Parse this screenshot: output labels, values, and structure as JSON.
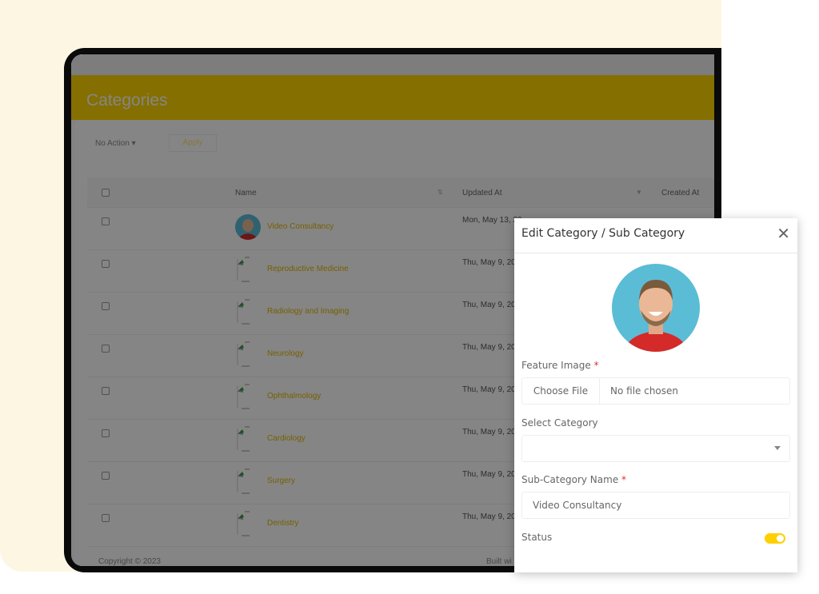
{
  "page": {
    "title": "Categories",
    "bulk_action": "No Action ▾",
    "apply_label": "Apply"
  },
  "table": {
    "headers": {
      "name": "Name",
      "updated_at": "Updated At",
      "created_at": "Created At"
    },
    "rows": [
      {
        "name": "Video Consultancy",
        "updated": "Mon, May 13, 20",
        "image": "avatar"
      },
      {
        "name": "Reproductive Medicine",
        "updated": "Thu, May 9, 20",
        "image": "broken-image"
      },
      {
        "name": "Radiology and Imaging",
        "updated": "Thu, May 9, 20",
        "image": "broken-image"
      },
      {
        "name": "Neurology",
        "updated": "Thu, May 9, 20",
        "image": "broken-image"
      },
      {
        "name": "Ophthalmology",
        "updated": "Thu, May 9, 20",
        "image": "broken-image"
      },
      {
        "name": "Cardiology",
        "updated": "Thu, May 9, 20",
        "image": "broken-image"
      },
      {
        "name": "Surgery",
        "updated": "Thu, May 9, 20",
        "image": "broken-image"
      },
      {
        "name": "Dentistry",
        "updated": "Thu, May 9, 20",
        "image": "broken-image"
      }
    ]
  },
  "footer": {
    "copyright": "Copyright © 2023",
    "built": "Built wi"
  },
  "modal": {
    "title": "Edit Category / Sub Category",
    "feature_image_label": "Feature Image",
    "choose_file": "Choose File",
    "no_file": "No file chosen",
    "select_category_label": "Select Category",
    "select_category_value": "",
    "subcat_label": "Sub-Category Name",
    "subcat_value": "Video Consultancy",
    "status_label": "Status",
    "status_on": true,
    "required_mark": "*"
  },
  "colors": {
    "accent": "#ffd500",
    "required": "#dd3333"
  }
}
